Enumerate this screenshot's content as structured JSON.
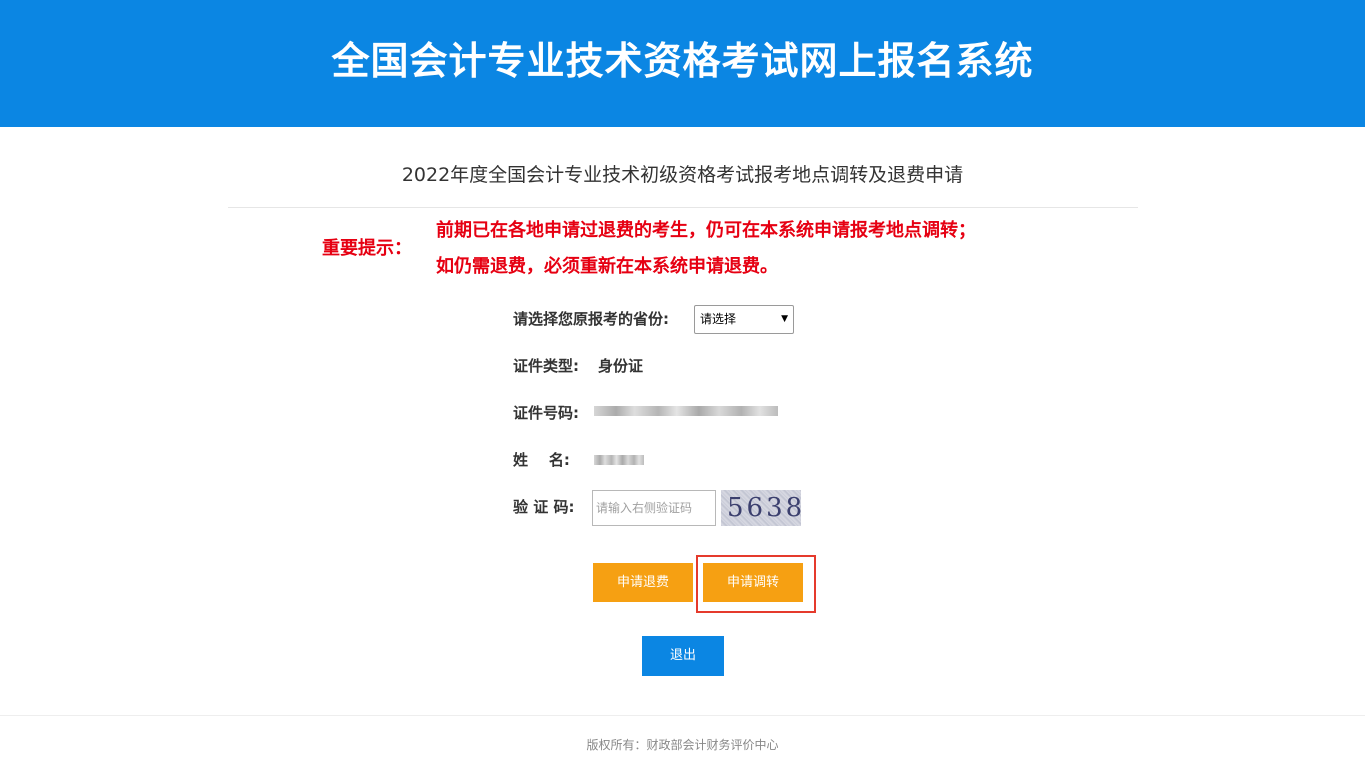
{
  "header": {
    "title": "全国会计专业技术资格考试网上报名系统"
  },
  "page": {
    "subtitle": "2022年度全国会计专业技术初级资格考试报考地点调转及退费申请"
  },
  "notice": {
    "label": "重要提示：",
    "line1": "前期已在各地申请过退费的考生，仍可在本系统申请报考地点调转；",
    "line2": "如仍需退费，必须重新在本系统申请退费。",
    "color": "#e60012"
  },
  "form": {
    "province_label": "请选择您原报考的省份:",
    "province_selected": "请选择",
    "id_type_label": "证件类型:",
    "id_type_value": "身份证",
    "id_number_label": "证件号码:",
    "name_label": "姓    名:",
    "captcha_label": "验 证 码:",
    "captcha_placeholder": "请输入右侧验证码",
    "captcha_code": "5638"
  },
  "buttons": {
    "refund": "申请退费",
    "transfer": "申请调转",
    "exit": "退出"
  },
  "footer": {
    "text": "版权所有：财政部会计财务评价中心"
  },
  "colors": {
    "header_bg": "#0b86e3",
    "primary_button": "#0b86e3",
    "action_button": "#f6a012",
    "highlight": "#e53a2c"
  }
}
